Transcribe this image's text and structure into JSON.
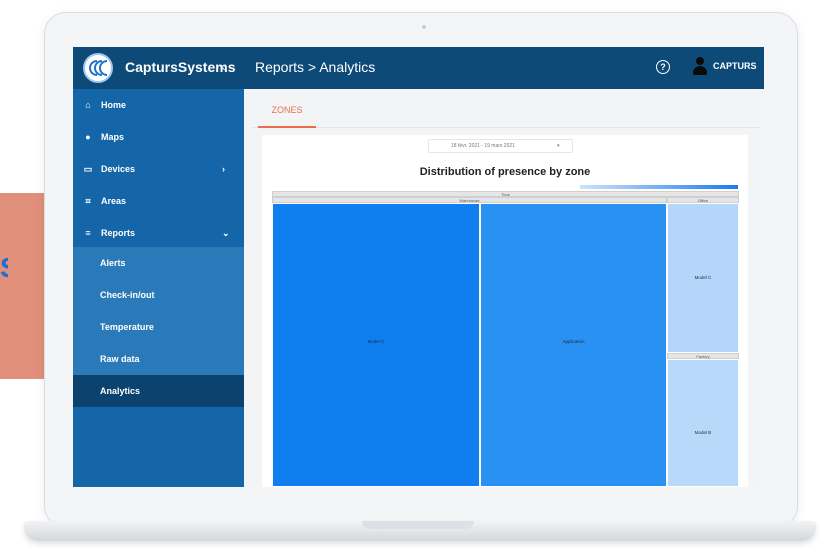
{
  "background": {
    "letter": "S",
    "accent": "#e0907a"
  },
  "topbar": {
    "brand": "CaptursSystems",
    "collapse_glyph": "‹",
    "breadcrumb": "Reports  >  Analytics",
    "help_icon": "?",
    "user_name": "CAPTURS",
    "color": "#0d4a78"
  },
  "sidebar": {
    "color": "#1466a8",
    "items": [
      {
        "label": "Home",
        "icon": "⌂",
        "chevron": ""
      },
      {
        "label": "Maps",
        "icon": "●",
        "chevron": ""
      },
      {
        "label": "Devices",
        "icon": "▭",
        "chevron": "›"
      },
      {
        "label": "Areas",
        "icon": "⌗",
        "chevron": ""
      },
      {
        "label": "Reports",
        "icon": "≡",
        "chevron": "⌄"
      }
    ],
    "subitems": [
      {
        "label": "Alerts"
      },
      {
        "label": "Check-in/out"
      },
      {
        "label": "Temperature"
      },
      {
        "label": "Raw data"
      },
      {
        "label": "Analytics",
        "active": true
      }
    ]
  },
  "main": {
    "tabs": [
      {
        "label": "ZONES",
        "active": true
      }
    ],
    "date_range": "18 févr. 2021 - 19 mars 2021",
    "date_caret": "▾",
    "chart_title": "Distribution of presence by zone"
  },
  "chart_data": {
    "type": "treemap",
    "title": "Distribution of presence by zone",
    "root": "Tous",
    "groups": [
      {
        "name": "Warehouse",
        "cells": [
          {
            "name": "Model C",
            "color": "#0f7ff0"
          },
          {
            "name": "Application",
            "color": "#2891f2"
          }
        ]
      },
      {
        "name": "Office",
        "cells": [
          {
            "name": "Model C",
            "color": "#b4d6fb"
          }
        ]
      },
      {
        "name": "Factory",
        "cells": [
          {
            "name": "Model B",
            "color": "#b9d9fb"
          }
        ]
      }
    ],
    "colorscale": [
      "#cfe3fb",
      "#1a7af0"
    ]
  }
}
